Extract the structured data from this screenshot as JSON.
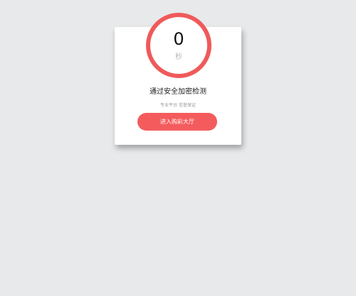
{
  "verification": {
    "timer_value": "0",
    "timer_unit": "秒",
    "title": "通过安全加密检测",
    "subtitle": "专业平台 信誉保证",
    "button_label": "进入购彩大厅"
  },
  "colors": {
    "page_background": "#e7e9ea",
    "card_background": "#ffffff",
    "accent": "#f05a5a",
    "button": "#f45b5d"
  }
}
